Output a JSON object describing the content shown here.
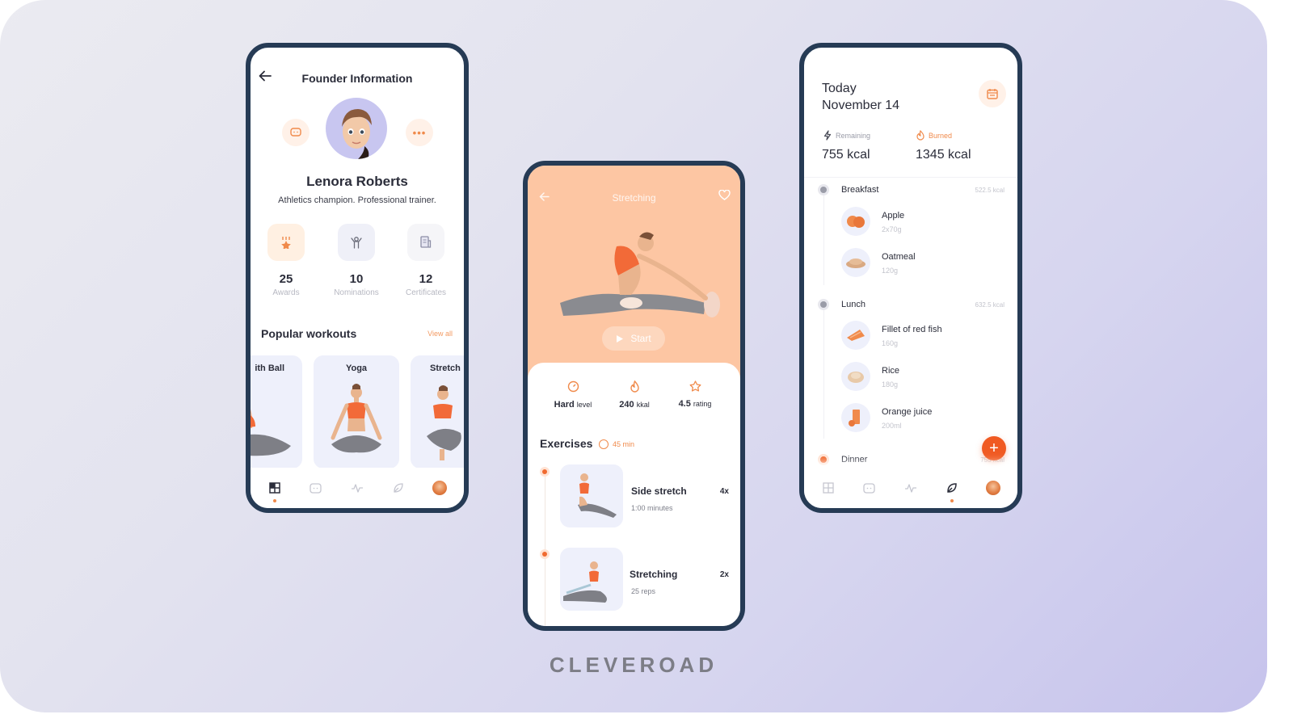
{
  "brand": "CLEVEROAD",
  "colors": {
    "accent": "#f08a4b",
    "accent_strong": "#f05a22",
    "frame": "#263b55",
    "hero": "#fdc6a3",
    "card_bg": "#eef0fb"
  },
  "founder_screen": {
    "back_icon": "arrow-left-icon",
    "title": "Founder Information",
    "chat_icon": "chat-icon",
    "more_label": "•••",
    "name": "Lenora Roberts",
    "bio": "Athletics champion. Professional trainer.",
    "stats": [
      {
        "icon": "award-icon",
        "value": "25",
        "label": "Awards"
      },
      {
        "icon": "trophy-person-icon",
        "value": "10",
        "label": "Nominations"
      },
      {
        "icon": "certificate-icon",
        "value": "12",
        "label": "Certificates"
      }
    ],
    "popular_title": "Popular workouts",
    "view_all": "View all",
    "workouts": [
      {
        "label": "ith Ball"
      },
      {
        "label": "Yoga"
      },
      {
        "label": "Stretch"
      }
    ],
    "nav": [
      {
        "icon": "dashboard-icon",
        "active": true
      },
      {
        "icon": "chat-icon",
        "active": false
      },
      {
        "icon": "activity-icon",
        "active": false
      },
      {
        "icon": "leaf-icon",
        "active": false
      },
      {
        "icon": "avatar-icon",
        "active": false
      }
    ]
  },
  "stretching_screen": {
    "title": "Stretching",
    "back_icon": "arrow-left-icon",
    "favorite_icon": "heart-icon",
    "start_label": "Start",
    "meta": [
      {
        "icon": "gauge-icon",
        "value": "Hard",
        "unit": "level"
      },
      {
        "icon": "flame-icon",
        "value": "240",
        "unit": "kkal"
      },
      {
        "icon": "star-icon",
        "value": "4.5",
        "unit": "rating"
      }
    ],
    "exercises_title": "Exercises",
    "exercises_duration": "45 min",
    "exercises": [
      {
        "name": "Side stretch",
        "sub": "1:00 minutes",
        "count": "4x"
      },
      {
        "name": "Stretching",
        "sub": "25 reps",
        "count": "2x"
      }
    ]
  },
  "nutrition_screen": {
    "day_label": "Today",
    "date": "November 14",
    "calendar_icon": "calendar-icon",
    "remaining_label": "Remaining",
    "remaining_value": "755 kcal",
    "burned_label": "Burned",
    "burned_value": "1345 kcal",
    "meals": [
      {
        "title": "Breakfast",
        "kcal": "522.5 kcal",
        "items": [
          {
            "name": "Apple",
            "qty": "2x70g"
          },
          {
            "name": "Oatmeal",
            "qty": "120g"
          }
        ]
      },
      {
        "title": "Lunch",
        "kcal": "632.5 kcal",
        "items": [
          {
            "name": "Fillet of red fish",
            "qty": "160g"
          },
          {
            "name": "Rice",
            "qty": "180g"
          },
          {
            "name": "Orange juice",
            "qty": "200ml"
          }
        ]
      },
      {
        "title": "Dinner",
        "kcal": "755 kcal",
        "items": []
      }
    ],
    "add_label": "+",
    "nav": [
      {
        "icon": "dashboard-icon",
        "active": false
      },
      {
        "icon": "chat-icon",
        "active": false
      },
      {
        "icon": "activity-icon",
        "active": false
      },
      {
        "icon": "leaf-icon",
        "active": true
      },
      {
        "icon": "avatar-icon",
        "active": false
      }
    ]
  }
}
